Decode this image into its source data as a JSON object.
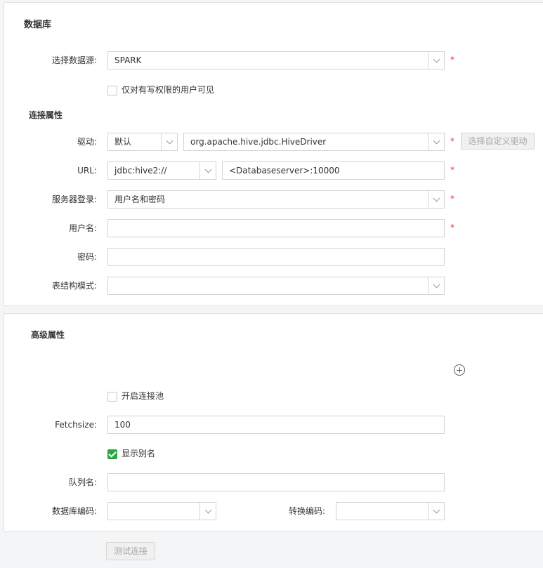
{
  "database_panel": {
    "title": "数据库",
    "datasource": {
      "label": "选择数据源:",
      "value": "SPARK",
      "required": "*"
    },
    "write_only_visible": {
      "label": "仅对有写权限的用户可见",
      "checked": false
    },
    "connection_title": "连接属性",
    "driver": {
      "label": "驱动:",
      "type_value": "默认",
      "class_value": "org.apache.hive.jdbc.HiveDriver",
      "required": "*",
      "custom_button": "选择自定义驱动"
    },
    "url": {
      "label": "URL:",
      "prefix_value": "jdbc:hive2://",
      "value": "<Databaseserver>:10000",
      "required": "*"
    },
    "server_login": {
      "label": "服务器登录:",
      "value": "用户名和密码",
      "required": "*"
    },
    "username": {
      "label": "用户名:",
      "value": "",
      "required": "*"
    },
    "password": {
      "label": "密码:",
      "value": ""
    },
    "schema": {
      "label": "表结构模式:",
      "value": ""
    }
  },
  "advanced_panel": {
    "title": "高级属性",
    "connection_pool": {
      "label": "开启连接池",
      "checked": false
    },
    "fetchsize": {
      "label": "Fetchsize:",
      "value": "100"
    },
    "show_alias": {
      "label": "显示别名",
      "checked": true
    },
    "queue_name": {
      "label": "队列名:",
      "value": ""
    },
    "db_encoding": {
      "label": "数据库编码:",
      "value": ""
    },
    "convert_encoding": {
      "label": "转换编码:",
      "value": ""
    }
  },
  "test_button": "测试连接",
  "colors": {
    "required": "#e53935",
    "checkbox_on": "#28a745",
    "border": "#d4d4d4"
  }
}
